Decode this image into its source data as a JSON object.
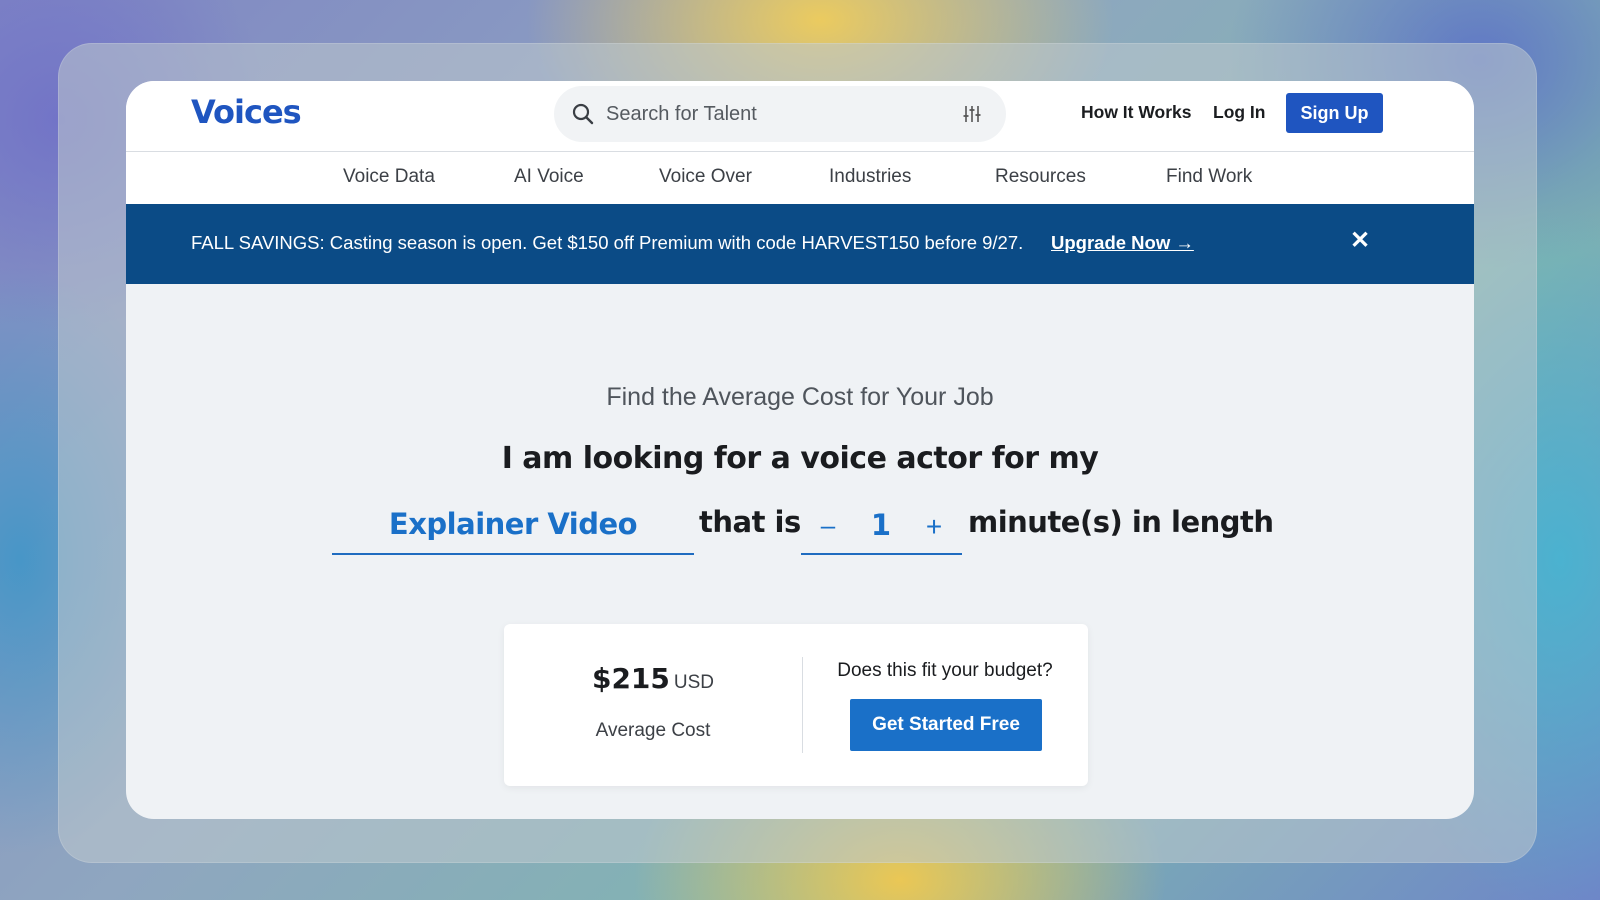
{
  "brand": {
    "name": "Voices"
  },
  "search": {
    "placeholder": "Search for Talent"
  },
  "header": {
    "how_it_works": "How It Works",
    "log_in": "Log In",
    "sign_up": "Sign Up"
  },
  "nav": {
    "items": [
      {
        "label": "Voice Data"
      },
      {
        "label": "AI Voice"
      },
      {
        "label": "Voice Over"
      },
      {
        "label": "Industries"
      },
      {
        "label": "Resources"
      },
      {
        "label": "Find Work"
      }
    ]
  },
  "banner": {
    "text": "FALL SAVINGS: Casting season is open. Get $150 off Premium with code HARVEST150 before 9/27.",
    "link": "Upgrade Now →",
    "close": "✕"
  },
  "calculator": {
    "subtitle": "Find the Average Cost for Your Job",
    "headline": "I am looking for a voice actor for my",
    "job_type": "Explainer Video",
    "that_is": "that is",
    "minus": "–",
    "minutes": "1",
    "plus": "+",
    "unit_text": "minute(s) in length"
  },
  "result": {
    "price": "$215",
    "currency": "USD",
    "label": "Average Cost",
    "question": "Does this fit your budget?",
    "cta": "Get Started Free"
  },
  "colors": {
    "brand_blue": "#1f55c0",
    "banner_bg": "#0b4b86",
    "accent_blue": "#1a70c8",
    "page_bg": "#eff2f5"
  }
}
